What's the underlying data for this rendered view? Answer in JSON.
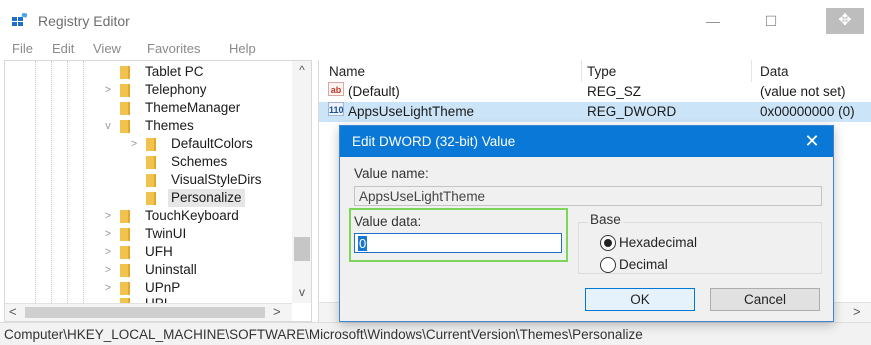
{
  "window": {
    "title": "Registry Editor",
    "icon": "registry-icon",
    "controls": {
      "minimize": "—",
      "maximize": "☐",
      "move": "✥"
    }
  },
  "menu": [
    "File",
    "Edit",
    "View",
    "Favorites",
    "Help"
  ],
  "tree": {
    "items": [
      {
        "label": "Tablet PC",
        "twisty": ""
      },
      {
        "label": "Telephony",
        "twisty": ">"
      },
      {
        "label": "ThemeManager",
        "twisty": ""
      },
      {
        "label": "Themes",
        "twisty": "v"
      },
      {
        "label": "DefaultColors",
        "twisty": ">"
      },
      {
        "label": "Schemes",
        "twisty": ""
      },
      {
        "label": "VisualStyleDirs",
        "twisty": ""
      },
      {
        "label": "Personalize",
        "twisty": "",
        "selected": true
      },
      {
        "label": "TouchKeyboard",
        "twisty": ">"
      },
      {
        "label": "TwinUI",
        "twisty": ">"
      },
      {
        "label": "UFH",
        "twisty": ">"
      },
      {
        "label": "Uninstall",
        "twisty": ">"
      },
      {
        "label": "UPnP",
        "twisty": ">"
      },
      {
        "label": "UPI",
        "twisty": ""
      }
    ]
  },
  "values": {
    "columns": {
      "name": "Name",
      "type": "Type",
      "data": "Data"
    },
    "rows": [
      {
        "name": "(Default)",
        "type": "REG_SZ",
        "data": "(value not set)",
        "icon": "ab"
      },
      {
        "name": "AppsUseLightTheme",
        "type": "REG_DWORD",
        "data": "0x00000000 (0)",
        "icon": "110"
      }
    ]
  },
  "status": {
    "path": "Computer\\HKEY_LOCAL_MACHINE\\SOFTWARE\\Microsoft\\Windows\\CurrentVersion\\Themes\\Personalize"
  },
  "dialog": {
    "title": "Edit DWORD (32-bit) Value",
    "close": "✕",
    "value_name_label": "Value name:",
    "value_name": "AppsUseLightTheme",
    "value_data_label": "Value data:",
    "value_data": "0",
    "base_label": "Base",
    "base_options": [
      {
        "label": "Hexadecimal",
        "selected": true
      },
      {
        "label": "Decimal",
        "selected": false
      }
    ],
    "ok": "OK",
    "cancel": "Cancel"
  },
  "scroll": {
    "up": "^",
    "down": "v",
    "left": "<",
    "right": ">"
  },
  "colors": {
    "dialog_title_bg": "#0a78d7",
    "selection_bg": "#cce4f7",
    "highlight_border": "#7cd65a",
    "folder": "#f2c24f"
  }
}
